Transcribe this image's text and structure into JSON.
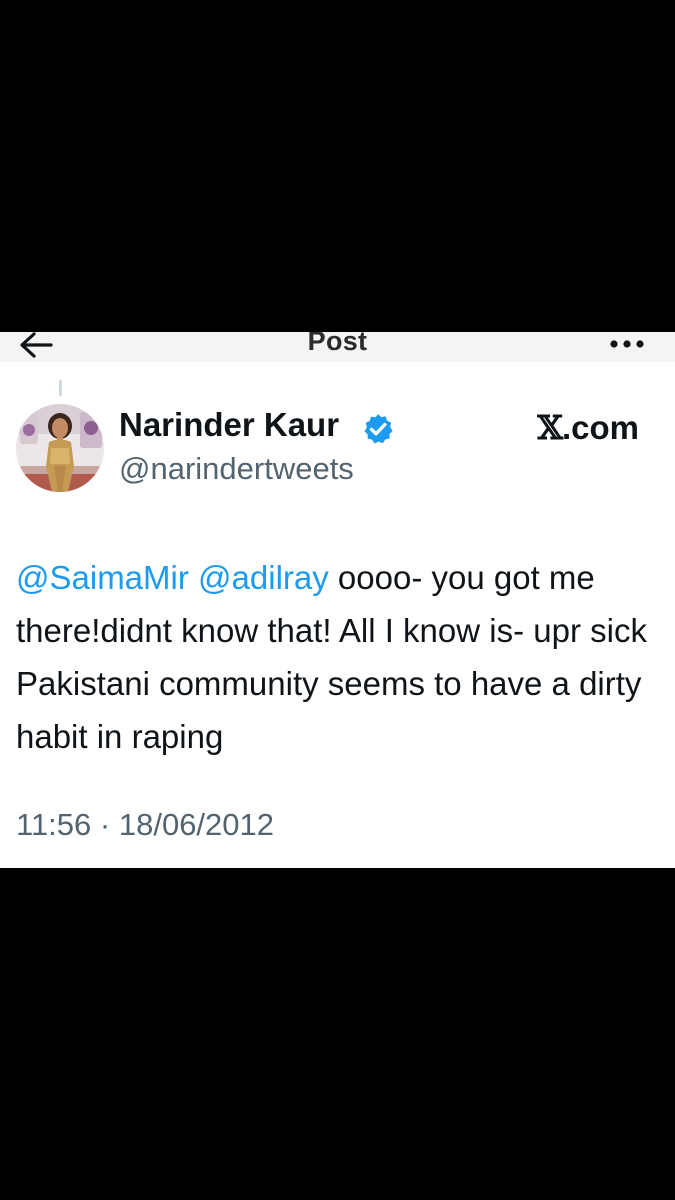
{
  "header": {
    "title": "Post",
    "back_icon": "arrow-left-icon",
    "more_icon": "more-horizontal-icon"
  },
  "author": {
    "name": "Narinder Kaur",
    "handle": "@narindertweets",
    "verified": true,
    "verified_icon": "verified-badge-icon",
    "avatar": "profile-photo"
  },
  "brand": {
    "x_glyph": "𝕏",
    "domain": ".com"
  },
  "tweet": {
    "mention_1": "@SaimaMir",
    "mention_2": "@adilray",
    "body": "oooo- you got me there!didnt know that! All I know is- upr sick Pakistani community seems to have a dirty habit in raping",
    "time": "11:56",
    "separator": "·",
    "date": "18/06/2012"
  },
  "colors": {
    "background": "#000000",
    "card": "#ffffff",
    "text": "#0f1419",
    "secondary": "#536471",
    "accent": "#1d9bf0"
  }
}
